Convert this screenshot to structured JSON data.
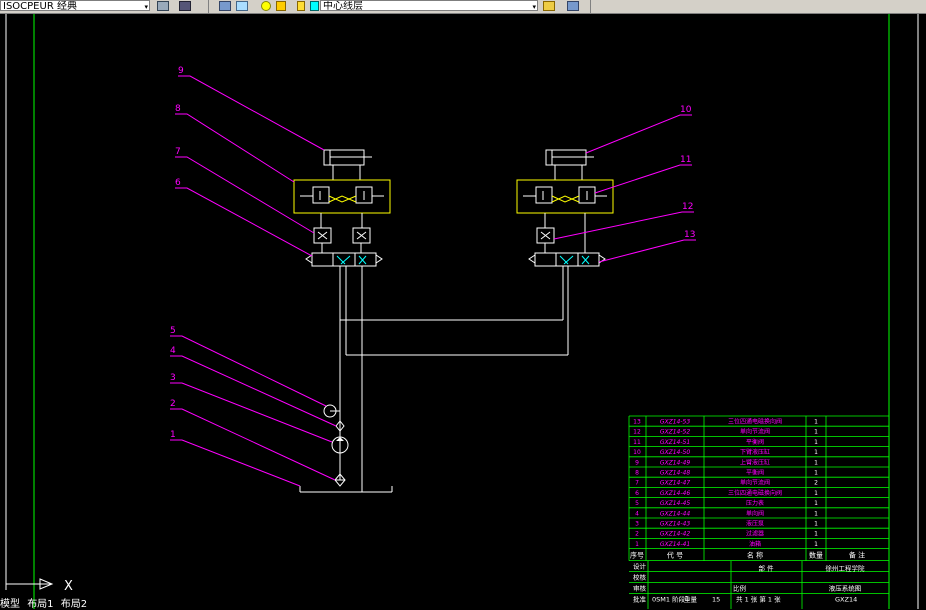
{
  "toolbar": {
    "layer_name": "ISOCPEUR 经典",
    "current_layer": "中心线层",
    "arrow": "▾"
  },
  "labels": {
    "l1": "1",
    "l2": "2",
    "l3": "3",
    "l4": "4",
    "l5": "5",
    "l6": "6",
    "l7": "7",
    "l8": "8",
    "l9": "9",
    "l10": "10",
    "l11": "11",
    "l12": "12",
    "l13": "13"
  },
  "ucs": {
    "x_label": "X"
  },
  "layout_tabs": [
    "模型",
    "布局1",
    "布局2"
  ],
  "bom": {
    "rows": [
      {
        "no": "13",
        "code": "GXZ14-53",
        "name": "三位四通电磁换向阀",
        "qty": "1"
      },
      {
        "no": "12",
        "code": "GXZ14-52",
        "name": "单向节流阀",
        "qty": "1"
      },
      {
        "no": "11",
        "code": "GXZ14-51",
        "name": "平衡阀",
        "qty": "1"
      },
      {
        "no": "10",
        "code": "GXZ14-50",
        "name": "下臂液压缸",
        "qty": "1"
      },
      {
        "no": "9",
        "code": "GXZ14-49",
        "name": "上臂液压缸",
        "qty": "1"
      },
      {
        "no": "8",
        "code": "GXZ14-48",
        "name": "平衡阀",
        "qty": "1"
      },
      {
        "no": "7",
        "code": "GXZ14-47",
        "name": "单向节流阀",
        "qty": "2"
      },
      {
        "no": "6",
        "code": "GXZ14-46",
        "name": "三位四通电磁换向阀",
        "qty": "1"
      },
      {
        "no": "5",
        "code": "GXZ14-45",
        "name": "压力表",
        "qty": "1"
      },
      {
        "no": "4",
        "code": "GXZ14-44",
        "name": "单向阀",
        "qty": "1"
      },
      {
        "no": "3",
        "code": "GXZ14-43",
        "name": "液压泵",
        "qty": "1"
      },
      {
        "no": "2",
        "code": "GXZ14-42",
        "name": "过滤器",
        "qty": "1"
      },
      {
        "no": "1",
        "code": "GXZ14-41",
        "name": "油箱",
        "qty": "1"
      }
    ],
    "header": {
      "no": "序号",
      "code": "代  号",
      "name": "名    称",
      "qty": "数量",
      "note": "备   注"
    },
    "title_block": {
      "design": "设计",
      "check": "校核",
      "audit": "审核",
      "approve": "批准",
      "part": "部    件",
      "school": "徐州工程学院",
      "scale": "比例",
      "drawing": "液压系统图",
      "sheets": "共 1 张 第 1 张",
      "code": "GXZ14",
      "stage": "0SM1 阶段",
      "weight_label": "重量",
      "weight": "15"
    }
  }
}
